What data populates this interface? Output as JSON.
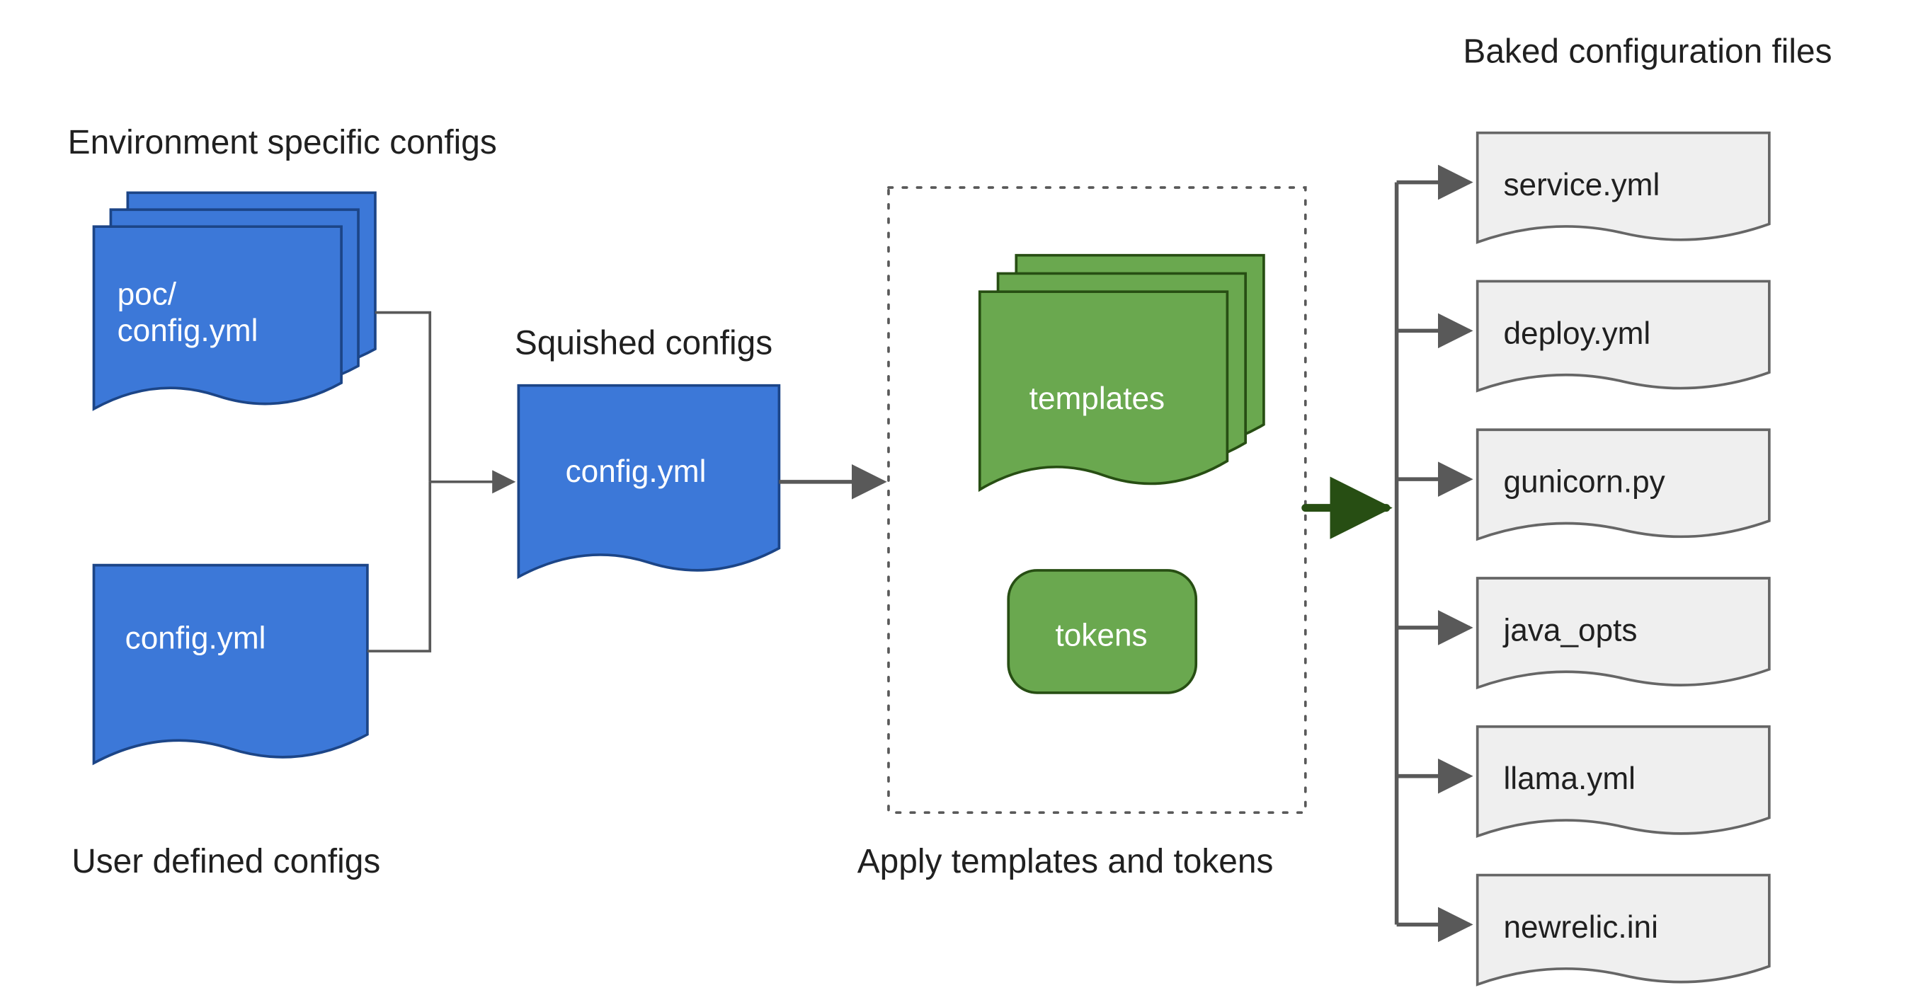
{
  "labels": {
    "env_configs": "Environment specific configs",
    "user_configs": "User defined configs",
    "squished": "Squished configs",
    "apply": "Apply templates and tokens",
    "baked": "Baked configuration files"
  },
  "blue_docs": {
    "env_doc_line1": "poc/",
    "env_doc_line2": " config.yml",
    "user_doc": "config.yml",
    "squished_doc": "config.yml"
  },
  "green": {
    "templates": "templates",
    "tokens": "tokens"
  },
  "outputs": [
    "service.yml",
    "deploy.yml",
    "gunicorn.py",
    "java_opts",
    "llama.yml",
    "newrelic.ini"
  ],
  "colors": {
    "blue_fill": "#3c78d8",
    "blue_stroke": "#1c4587",
    "green_fill": "#6aa84f",
    "green_stroke": "#274e13",
    "grey_fill": "#efefef",
    "grey_stroke": "#666666",
    "connector": "#595959"
  }
}
